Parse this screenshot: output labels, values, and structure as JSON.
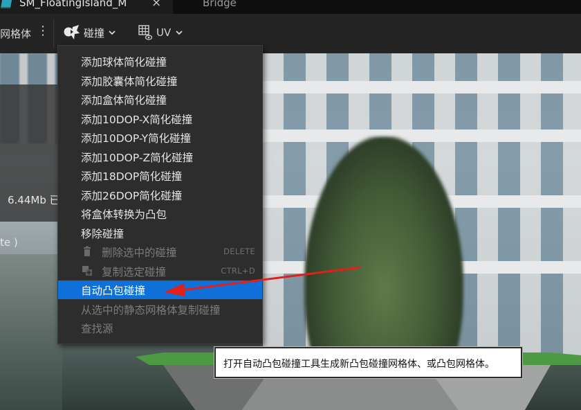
{
  "tabs": [
    {
      "title": "SM_FloatingIsland_M",
      "close": "×",
      "icon": "static-mesh-icon"
    },
    {
      "title": "Bridge"
    }
  ],
  "toolbar": {
    "mesh_label": "网格体",
    "more_icon": "⋮",
    "collision_label": "碰撞",
    "collision_icon": "collision-icon",
    "uv_label": "UV",
    "uv_icon": "uv-grid-icon",
    "chevron": "⌄"
  },
  "viewport": {
    "size_text": "6.44Mb 已",
    "te_text": "te )"
  },
  "collision_menu": {
    "items": [
      {
        "label": "添加球体简化碰撞",
        "enabled": true
      },
      {
        "label": "添加胶囊体简化碰撞",
        "enabled": true
      },
      {
        "label": "添加盒体简化碰撞",
        "enabled": true
      },
      {
        "label": "添加10DOP-X简化碰撞",
        "enabled": true
      },
      {
        "label": "添加10DOP-Y简化碰撞",
        "enabled": true
      },
      {
        "label": "添加10DOP-Z简化碰撞",
        "enabled": true
      },
      {
        "label": "添加18DOP简化碰撞",
        "enabled": true
      },
      {
        "label": "添加26DOP简化碰撞",
        "enabled": true
      },
      {
        "label": "将盒体转换为凸包",
        "enabled": true
      },
      {
        "label": "移除碰撞",
        "enabled": true
      },
      {
        "label": "删除选中的碰撞",
        "enabled": false,
        "shortcut": "DELETE",
        "icon": "trash-icon"
      },
      {
        "label": "复制选定碰撞",
        "enabled": false,
        "shortcut": "CTRL+D",
        "icon": "duplicate-icon"
      },
      {
        "label": "自动凸包碰撞",
        "enabled": true,
        "highlighted": true
      },
      {
        "label": "从选中的静态网格体复制碰撞",
        "enabled": false
      },
      {
        "label": "查找源",
        "enabled": false
      }
    ]
  },
  "tooltip": {
    "text": "打开自动凸包碰撞工具生成新凸包碰撞网格体、或凸包网格体。"
  },
  "colors": {
    "highlight": "#0e70d8",
    "annotation_arrow": "#e0201b",
    "menu_bg": "#2d2d2d"
  }
}
